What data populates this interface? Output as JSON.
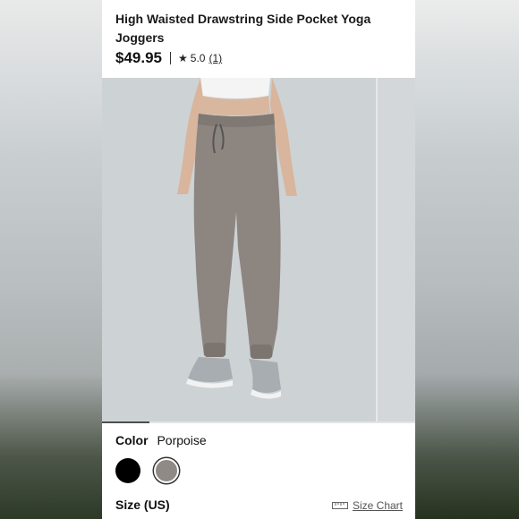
{
  "product": {
    "title": "High Waisted Drawstring Side Pocket Yoga Joggers",
    "price": "$49.95",
    "rating": "5.0",
    "review_count": "(1)"
  },
  "gallery": {
    "progress_fraction": 0.15
  },
  "color": {
    "label": "Color",
    "selected": "Porpoise",
    "swatches": [
      {
        "name": "Black",
        "hex": "#000000"
      },
      {
        "name": "Porpoise",
        "hex": "#8f8a86"
      }
    ]
  },
  "size": {
    "label": "Size (US)",
    "chart_link": "Size Chart"
  },
  "icons": {
    "rating": "star-icon",
    "size_chart": "ruler-icon"
  }
}
